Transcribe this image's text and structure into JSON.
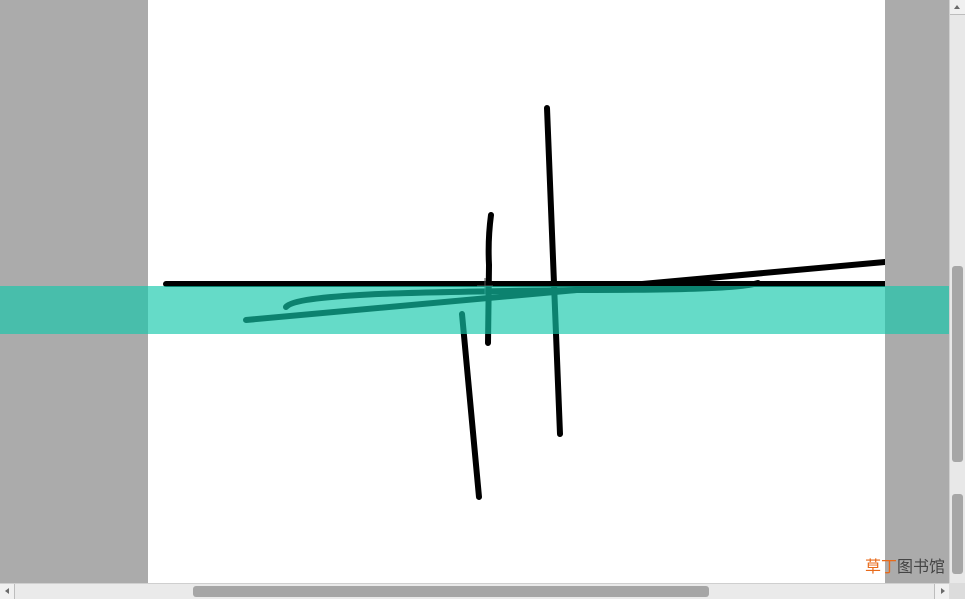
{
  "watermark": {
    "accent_text": "草丁",
    "rest_text": "图书馆"
  },
  "colors": {
    "margin_gray": "#ababab",
    "canvas_white": "#ffffff",
    "stroke_black": "#000000",
    "highlight_teal": "#12c8aa"
  },
  "icons": {
    "scroll_up": "triangle-up",
    "scroll_left": "triangle-left",
    "scroll_right": "triangle-right"
  }
}
